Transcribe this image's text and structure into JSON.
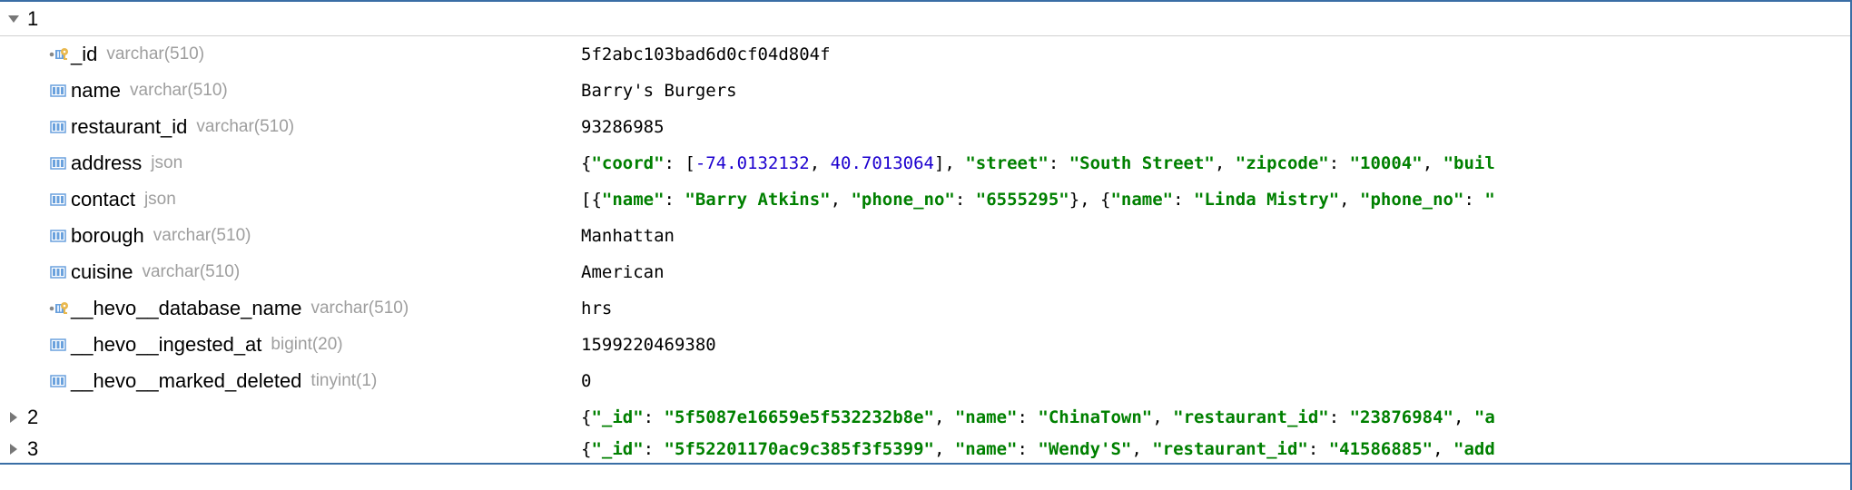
{
  "rows": {
    "expanded": {
      "number": "1",
      "fields": [
        {
          "icon": "pk",
          "name": "_id",
          "type": "varchar(510)",
          "value_kind": "plain",
          "value": "5f2abc103bad6d0cf04d804f"
        },
        {
          "icon": "col",
          "name": "name",
          "type": "varchar(510)",
          "value_kind": "plain",
          "value": "Barry's Burgers"
        },
        {
          "icon": "col",
          "name": "restaurant_id",
          "type": "varchar(510)",
          "value_kind": "plain",
          "value": "93286985"
        },
        {
          "icon": "col",
          "name": "address",
          "type": "json",
          "value_kind": "json_address",
          "tokens": {
            "k_coord": "\"coord\"",
            "n1": "-74.0132132",
            "n2": "40.7013064",
            "k_street": "\"street\"",
            "v_street": "\"South Street\"",
            "k_zip": "\"zipcode\"",
            "v_zip": "\"10004\"",
            "k_buil": "\"buil"
          }
        },
        {
          "icon": "col",
          "name": "contact",
          "type": "json",
          "value_kind": "json_contact",
          "tokens": {
            "k_name1": "\"name\"",
            "v_name1": "\"Barry Atkins\"",
            "k_phone1": "\"phone_no\"",
            "v_phone1": "\"6555295\"",
            "k_name2": "\"name\"",
            "v_name2": "\"Linda Mistry\"",
            "k_phone2": "\"phone_no\"",
            "v_phone2_trail": "\""
          }
        },
        {
          "icon": "col",
          "name": "borough",
          "type": "varchar(510)",
          "value_kind": "plain",
          "value": "Manhattan"
        },
        {
          "icon": "col",
          "name": "cuisine",
          "type": "varchar(510)",
          "value_kind": "plain",
          "value": "American"
        },
        {
          "icon": "pk",
          "name": "__hevo__database_name",
          "type": "varchar(510)",
          "value_kind": "plain",
          "value": "hrs"
        },
        {
          "icon": "col",
          "name": "__hevo__ingested_at",
          "type": "bigint(20)",
          "value_kind": "plain",
          "value": "1599220469380"
        },
        {
          "icon": "col",
          "name": "__hevo__marked_deleted",
          "type": "tinyint(1)",
          "value_kind": "plain",
          "value": "0"
        }
      ]
    },
    "collapsed": [
      {
        "number": "2",
        "tokens": {
          "k_id": "\"_id\"",
          "v_id": "\"5f5087e16659e5f532232b8e\"",
          "k_name": "\"name\"",
          "v_name": "\"ChinaTown\"",
          "k_rid": "\"restaurant_id\"",
          "v_rid": "\"23876984\"",
          "k_trail": "\"a"
        }
      },
      {
        "number": "3",
        "tokens": {
          "k_id": "\"_id\"",
          "v_id": "\"5f52201170ac9c385f3f5399\"",
          "k_name": "\"name\"",
          "v_name": "\"Wendy'S\"",
          "k_rid": "\"restaurant_id\"",
          "v_rid": "\"41586885\"",
          "k_trail": "\"add"
        }
      }
    ]
  }
}
